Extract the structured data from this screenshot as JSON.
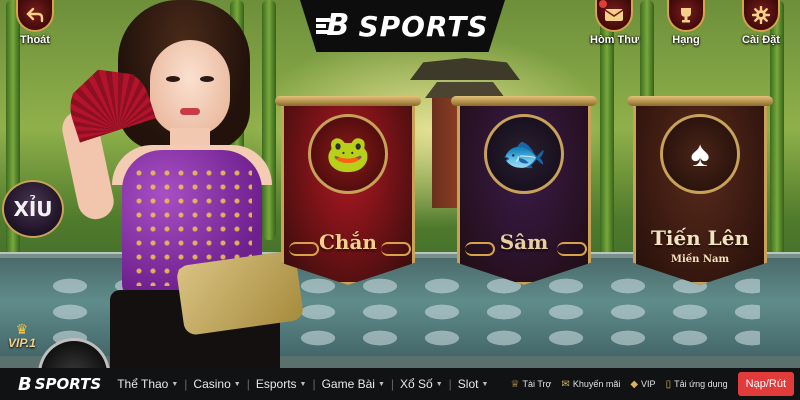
{
  "brand": {
    "logo_letter": "B",
    "logo_text": "SPORTS"
  },
  "top_buttons": {
    "back": {
      "label": "Thoát",
      "icon": "back-arrow-icon"
    },
    "mail": {
      "label": "Hòm Thư",
      "icon": "mail-icon"
    },
    "rank": {
      "label": "Hạng",
      "icon": "trophy-icon"
    },
    "settings": {
      "label": "Cài Đặt",
      "icon": "gear-icon"
    }
  },
  "games": [
    {
      "title": "Chắn",
      "subtitle": "",
      "color": "#b01822",
      "title_color": "#f3d189"
    },
    {
      "title": "Sâm",
      "subtitle": "",
      "color": "#3a1b4a",
      "title_color": "#e9cfa0"
    },
    {
      "title": "Tiến Lên",
      "subtitle": "Miền Nam",
      "color": "#5a2a1c",
      "title_color": "#f3e2c0"
    }
  ],
  "side": {
    "xiu_label": "XỈU",
    "vip_label": "VIP.1"
  },
  "bottom_nav": {
    "logo_letter": "B",
    "logo_text": "SPORTS",
    "items": [
      "Thể Thao",
      "Casino",
      "Esports",
      "Game Bài",
      "Xổ Số",
      "Slot"
    ],
    "right_items": [
      {
        "label": "Tài Trợ",
        "icon": "sponsor-icon"
      },
      {
        "label": "Khuyến mãi",
        "icon": "gift-icon"
      },
      {
        "label": "VIP",
        "icon": "diamond-icon"
      },
      {
        "label": "Tải ứng dụng",
        "icon": "phone-icon"
      }
    ],
    "cta": "Nạp/Rút"
  },
  "colors": {
    "accent_red": "#e23b3b",
    "gold": "#d7a24a",
    "nav_bg": "#111214"
  }
}
